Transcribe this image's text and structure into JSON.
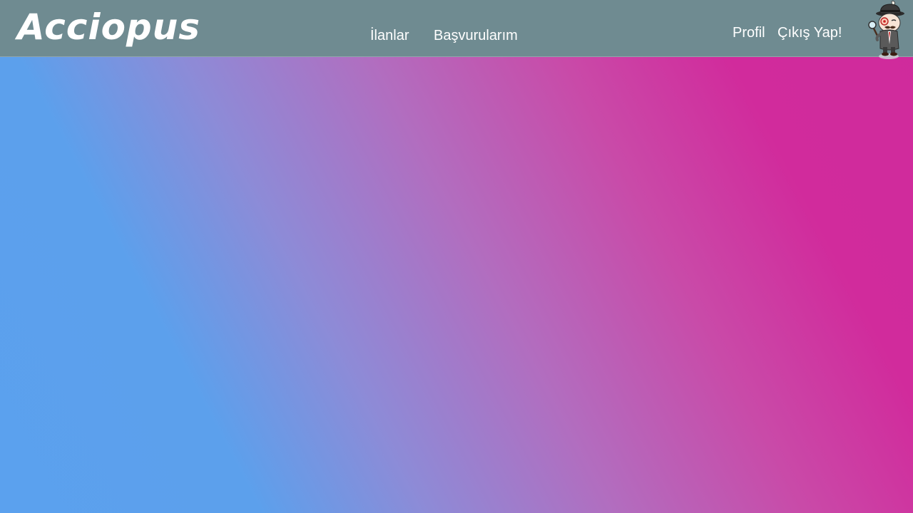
{
  "navbar": {
    "brand": "Acciopus",
    "links": {
      "listings": "İlanlar",
      "applications": "Başvurularım",
      "profile": "Profil",
      "logout": "Çıkış Yap!"
    },
    "mascot_icon": "detective-octopus-mascot-icon"
  },
  "colors": {
    "navbar_bg": "#6f8b91",
    "gradient_start": "#5ba1ee",
    "gradient_end": "#d12b9c",
    "text": "#ffffff"
  }
}
